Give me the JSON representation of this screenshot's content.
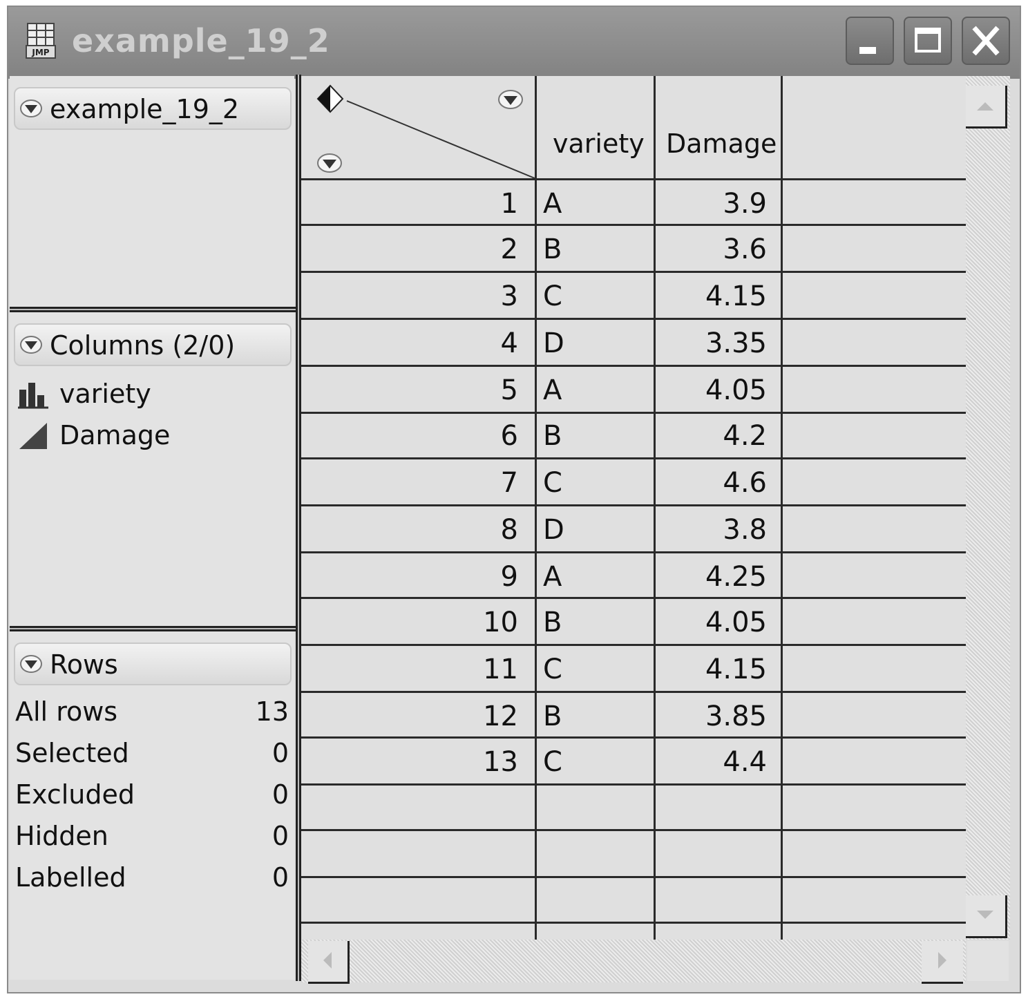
{
  "window": {
    "title": "example_19_2",
    "icon_text": "JMP"
  },
  "left_panel": {
    "table_name": "example_19_2",
    "columns_header": "Columns (2/0)",
    "columns": [
      {
        "name": "variety",
        "icon": "nominal-bar-chart-icon"
      },
      {
        "name": "Damage",
        "icon": "continuous-ramp-icon"
      }
    ],
    "rows_header": "Rows",
    "row_stats": [
      {
        "label": "All rows",
        "value": "13"
      },
      {
        "label": "Selected",
        "value": "0"
      },
      {
        "label": "Excluded",
        "value": "0"
      },
      {
        "label": "Hidden",
        "value": "0"
      },
      {
        "label": "Labelled",
        "value": "0"
      }
    ]
  },
  "table": {
    "headers": [
      "variety",
      "Damage"
    ],
    "rows": [
      [
        "1",
        "A",
        "3.9"
      ],
      [
        "2",
        "B",
        "3.6"
      ],
      [
        "3",
        "C",
        "4.15"
      ],
      [
        "4",
        "D",
        "3.35"
      ],
      [
        "5",
        "A",
        "4.05"
      ],
      [
        "6",
        "B",
        "4.2"
      ],
      [
        "7",
        "C",
        "4.6"
      ],
      [
        "8",
        "D",
        "3.8"
      ],
      [
        "9",
        "A",
        "4.25"
      ],
      [
        "10",
        "B",
        "4.05"
      ],
      [
        "11",
        "C",
        "4.15"
      ],
      [
        "12",
        "B",
        "3.85"
      ],
      [
        "13",
        "C",
        "4.4"
      ]
    ]
  }
}
